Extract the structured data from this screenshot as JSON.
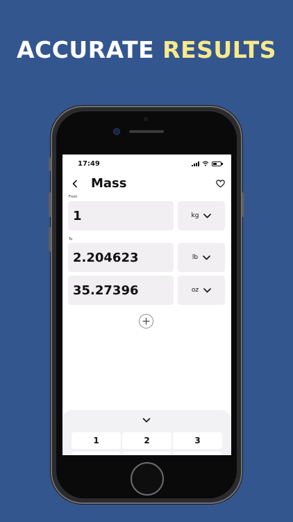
{
  "headline": {
    "part1": "ACCURATE",
    "part2": "RESULTS"
  },
  "status_bar": {
    "time": "17:49"
  },
  "header": {
    "title": "Mass"
  },
  "from": {
    "label": "From",
    "value": "1",
    "unit": "kg"
  },
  "to": {
    "label": "To",
    "rows": [
      {
        "value": "2.204623",
        "unit": "lb"
      },
      {
        "value": "35.27396",
        "unit": "oz"
      }
    ]
  },
  "keypad": {
    "keys": [
      "1",
      "2",
      "3"
    ]
  },
  "colors": {
    "background": "#34568f",
    "accent": "#f7ea8c",
    "field": "#f1eff2"
  },
  "icons": [
    "back-icon",
    "heart-icon",
    "chevron-down-icon",
    "plus-icon",
    "wifi-icon",
    "signal-icon",
    "battery-icon"
  ]
}
